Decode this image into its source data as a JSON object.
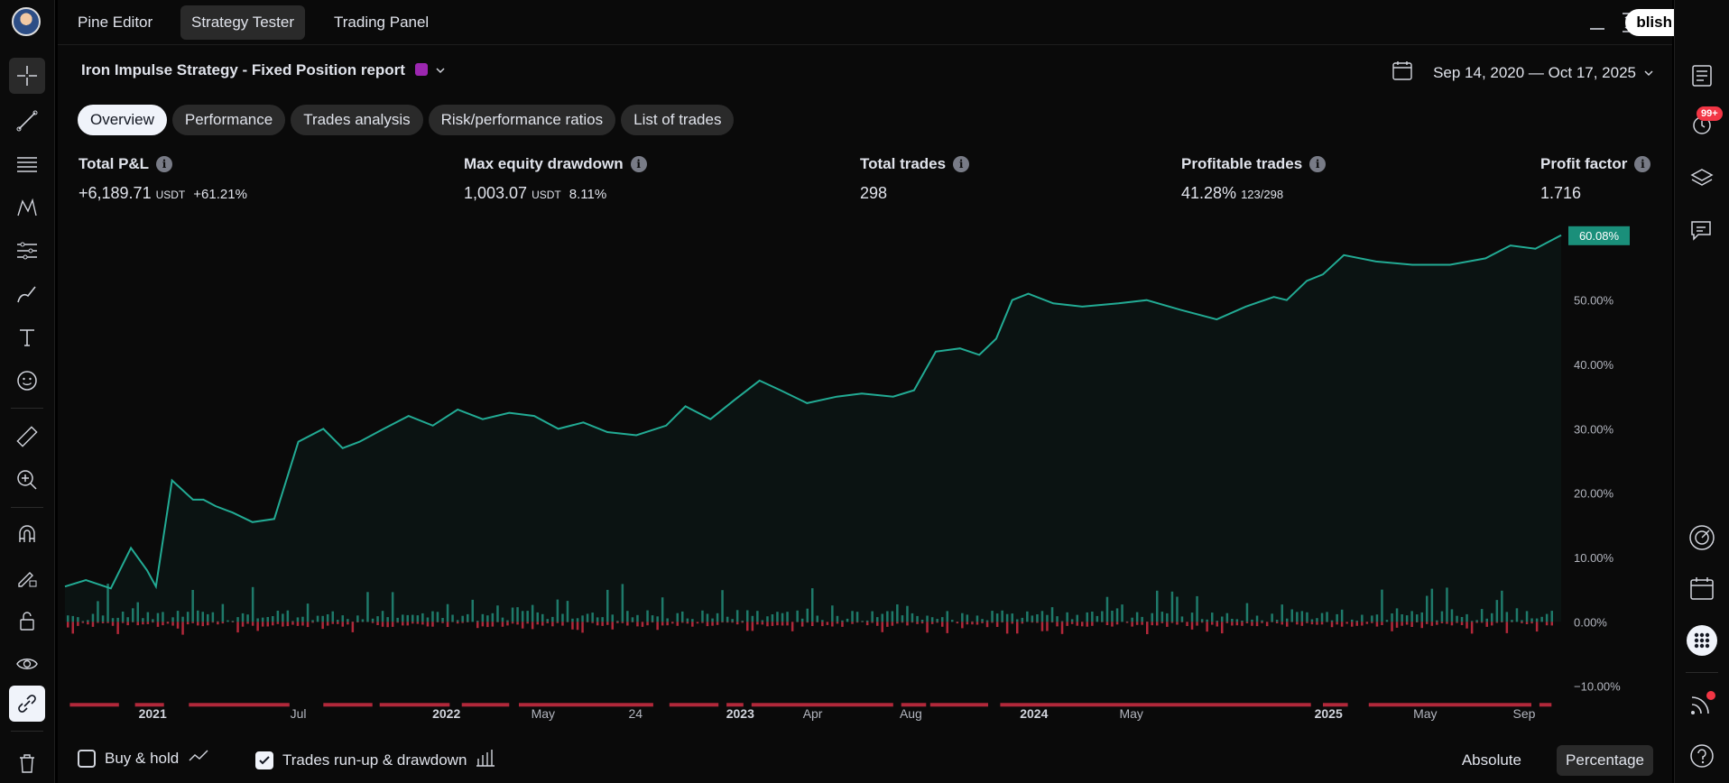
{
  "topbar": {
    "tabs": [
      "Pine Editor",
      "Strategy Tester",
      "Trading Panel"
    ],
    "active_tab": 1,
    "publish_label": "blish"
  },
  "report": {
    "title": "Iron Impulse Strategy - Fixed Position report",
    "date_range": "Sep 14, 2020 — Oct 17, 2025"
  },
  "tabs": [
    "Overview",
    "Performance",
    "Trades analysis",
    "Risk/performance ratios",
    "List of trades"
  ],
  "metrics": {
    "total_pnl": {
      "label": "Total P&L",
      "value": "+6,189.71",
      "unit": "USDT",
      "pct": "+61.21%"
    },
    "max_drawdown": {
      "label": "Max equity drawdown",
      "value": "1,003.07",
      "unit": "USDT",
      "pct": "8.11%"
    },
    "total_trades": {
      "label": "Total trades",
      "value": "298"
    },
    "profitable_trades": {
      "label": "Profitable trades",
      "value": "41.28%",
      "sub": "123/298"
    },
    "profit_factor": {
      "label": "Profit factor",
      "value": "1.716"
    }
  },
  "notifications_badge": "99+",
  "bottom": {
    "buy_hold_label": "Buy & hold",
    "buy_hold_checked": false,
    "runup_label": "Trades run-up & drawdown",
    "runup_checked": true,
    "absolute_label": "Absolute",
    "percentage_label": "Percentage",
    "active_mode": "Percentage"
  },
  "colors": {
    "equity_line": "#22ab94",
    "runup_bar": "#1e7a6a",
    "drawdown_bar": "#b2283a",
    "last_value_bg": "#1a8f7a"
  },
  "chart_data": {
    "type": "line",
    "title": "",
    "xlabel": "",
    "ylabel": "",
    "ylim": [
      -12,
      63
    ],
    "y_ticks": [
      "−10.00%",
      "0.00%",
      "10.00%",
      "20.00%",
      "30.00%",
      "40.00%",
      "50.00%"
    ],
    "y_tick_values": [
      -10,
      0,
      10,
      20,
      30,
      40,
      50
    ],
    "last_value_label": "60.08%",
    "x_tick_labels": [
      "2021",
      "Jul",
      "2022",
      "May",
      "24",
      "2023",
      "Apr",
      "Aug",
      "2024",
      "May",
      "2025",
      "May",
      "Sep"
    ],
    "x_tick_dates": [
      "2021-01-01",
      "2021-07-01",
      "2022-01-01",
      "2022-05-01",
      "2022-08-24",
      "2023-01-01",
      "2023-04-01",
      "2023-08-01",
      "2024-01-01",
      "2024-05-01",
      "2025-01-01",
      "2025-05-01",
      "2025-09-01"
    ],
    "x_range": [
      "2020-09-14",
      "2025-10-17"
    ],
    "series": [
      {
        "type": "line",
        "x": [
          "2020-09-14",
          "2020-10-10",
          "2020-11-10",
          "2020-12-05",
          "2020-12-25",
          "2021-01-05",
          "2021-01-25",
          "2021-02-20",
          "2021-03-05",
          "2021-03-20",
          "2021-04-10",
          "2021-05-05",
          "2021-06-01",
          "2021-07-01",
          "2021-08-01",
          "2021-08-25",
          "2021-09-15",
          "2021-10-15",
          "2021-11-15",
          "2021-12-15",
          "2022-01-15",
          "2022-02-15",
          "2022-03-20",
          "2022-04-20",
          "2022-05-20",
          "2022-06-20",
          "2022-07-20",
          "2022-08-25",
          "2022-10-01",
          "2022-10-25",
          "2022-11-25",
          "2022-12-25",
          "2023-01-25",
          "2023-02-20",
          "2023-03-25",
          "2023-05-01",
          "2023-06-01",
          "2023-07-10",
          "2023-08-05",
          "2023-09-01",
          "2023-10-01",
          "2023-10-25",
          "2023-11-15",
          "2023-12-05",
          "2023-12-25",
          "2024-01-25",
          "2024-03-01",
          "2024-04-15",
          "2024-05-20",
          "2024-07-01",
          "2024-08-15",
          "2024-09-20",
          "2024-10-25",
          "2024-11-10",
          "2024-12-05",
          "2024-12-25",
          "2025-01-20",
          "2025-03-01",
          "2025-04-15",
          "2025-06-01",
          "2025-07-15",
          "2025-08-15",
          "2025-09-15",
          "2025-10-17"
        ],
        "y": [
          5.5,
          6.5,
          5.2,
          11.5,
          8,
          5.5,
          22,
          19,
          19,
          18,
          17,
          15.5,
          16,
          28,
          30,
          27,
          28,
          30,
          32,
          30.5,
          33,
          31.5,
          32.5,
          32,
          30,
          31,
          29.5,
          29,
          30.5,
          33.5,
          31.5,
          34.5,
          37.5,
          36,
          34,
          35,
          35.5,
          35,
          36,
          42,
          42.5,
          41.5,
          44,
          50,
          51,
          49.5,
          49,
          49.5,
          50,
          48.5,
          47,
          49,
          50.5,
          50,
          53,
          54,
          57,
          56,
          55.5,
          55.5,
          56.5,
          58.5,
          58,
          60.08
        ]
      }
    ],
    "trade_bars_note": "per-trade run-up (green, up) and drawdown (red, down) bars near 0%",
    "drawdown_segments": [
      [
        "2020-09-20",
        "2020-11-20"
      ],
      [
        "2020-12-10",
        "2021-01-15"
      ],
      [
        "2021-02-15",
        "2021-06-20"
      ],
      [
        "2021-08-01",
        "2021-10-01"
      ],
      [
        "2021-10-10",
        "2022-01-05"
      ],
      [
        "2022-01-20",
        "2022-03-20"
      ],
      [
        "2022-04-01",
        "2022-09-15"
      ],
      [
        "2022-10-05",
        "2022-12-05"
      ],
      [
        "2022-12-15",
        "2023-01-05"
      ],
      [
        "2023-01-15",
        "2023-07-10"
      ],
      [
        "2023-07-20",
        "2023-08-20"
      ],
      [
        "2023-08-25",
        "2023-11-05"
      ],
      [
        "2023-11-20",
        "2024-12-10"
      ],
      [
        "2024-12-25",
        "2025-01-25"
      ],
      [
        "2025-02-20",
        "2025-09-10"
      ],
      [
        "2025-09-20",
        "2025-10-05"
      ]
    ]
  }
}
